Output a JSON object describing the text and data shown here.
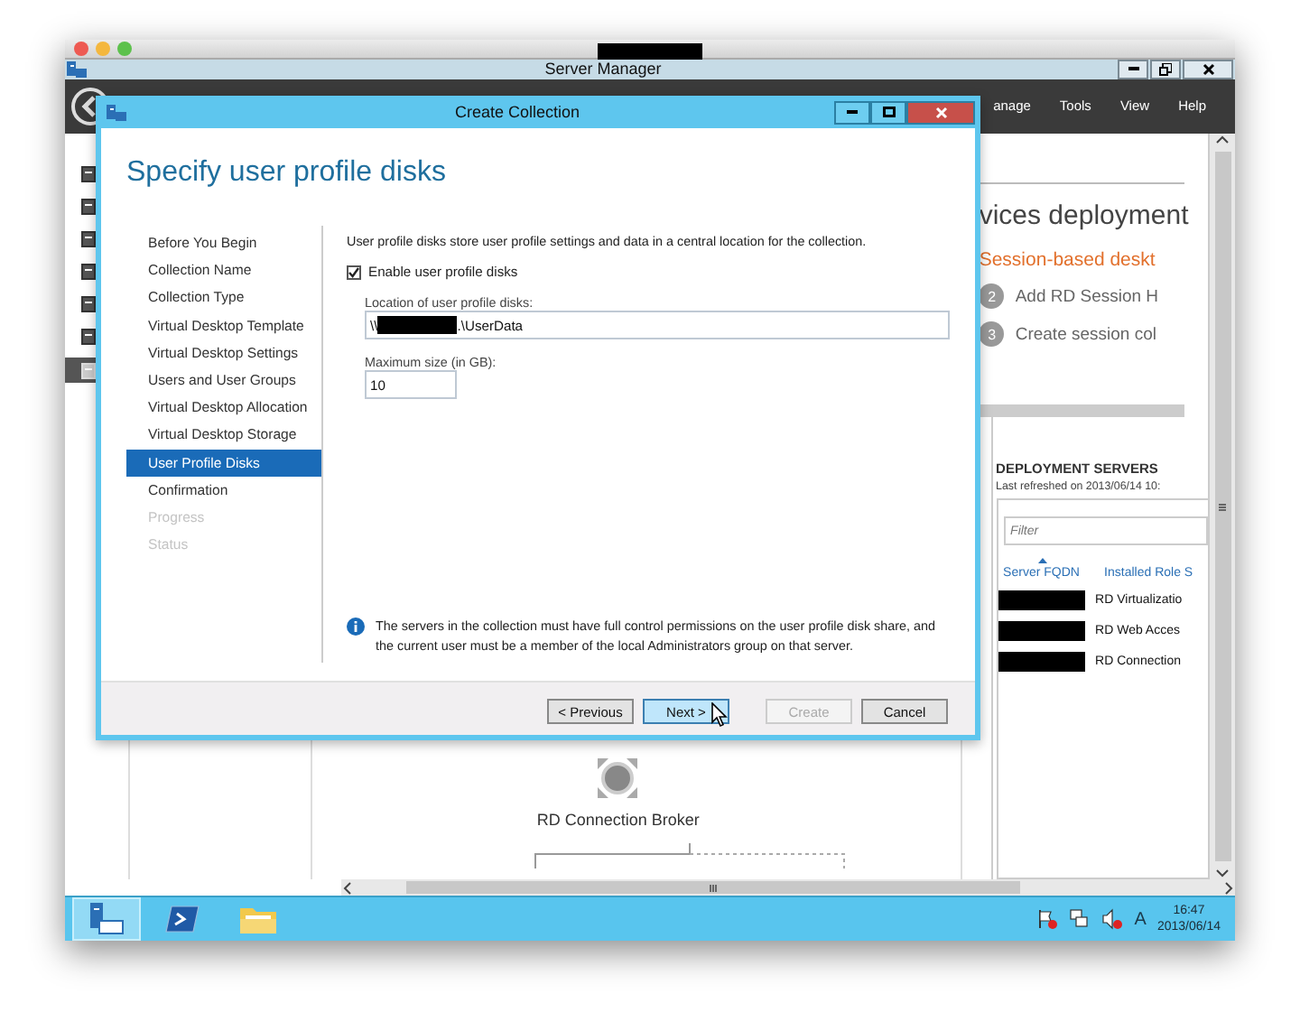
{
  "server_manager": {
    "title": "Server Manager",
    "menu": [
      "anage",
      "Tools",
      "View",
      "Help"
    ],
    "nav_items": [
      {
        "selected": false
      },
      {
        "selected": false
      },
      {
        "selected": false
      },
      {
        "selected": false
      },
      {
        "selected": false
      },
      {
        "selected": false
      },
      {
        "selected": true
      }
    ],
    "overview": {
      "heading": "vices deployment",
      "subheading": "Session-based deskt",
      "steps": [
        {
          "number": "2",
          "label": "Add RD Session H"
        },
        {
          "number": "3",
          "label": "Create session col"
        }
      ]
    },
    "diagram": {
      "node_label": "RD Connection Broker"
    },
    "deployment_servers": {
      "title": "DEPLOYMENT SERVERS",
      "last_refreshed": "Last refreshed on 2013/06/14 10:",
      "filter": {
        "placeholder": "Filter"
      },
      "columns": [
        "Server FQDN",
        "Installed Role S"
      ],
      "rows": [
        {
          "role": "RD Virtualizatio"
        },
        {
          "role": "RD Web Acces"
        },
        {
          "role": "RD Connection"
        }
      ]
    }
  },
  "dialog": {
    "title": "Create Collection",
    "heading": "Specify user profile disks",
    "steps": [
      {
        "label": "Before You Begin",
        "selected": false,
        "disabled": false
      },
      {
        "label": "Collection Name",
        "selected": false,
        "disabled": false
      },
      {
        "label": "Collection Type",
        "selected": false,
        "disabled": false
      },
      {
        "label": "Virtual Desktop Template",
        "selected": false,
        "disabled": false
      },
      {
        "label": "Virtual Desktop Settings",
        "selected": false,
        "disabled": false
      },
      {
        "label": "Users and User Groups",
        "selected": false,
        "disabled": false
      },
      {
        "label": "Virtual Desktop Allocation",
        "selected": false,
        "disabled": false
      },
      {
        "label": "Virtual Desktop Storage",
        "selected": false,
        "disabled": false
      },
      {
        "label": "User Profile Disks",
        "selected": true,
        "disabled": false
      },
      {
        "label": "Confirmation",
        "selected": false,
        "disabled": false
      },
      {
        "label": "Progress",
        "selected": false,
        "disabled": true
      },
      {
        "label": "Status",
        "selected": false,
        "disabled": true
      }
    ],
    "description": "User profile disks store user profile settings and data in a central location for the collection.",
    "enable_checkbox": {
      "label": "Enable user profile disks",
      "checked": true
    },
    "location": {
      "label": "Location of user profile disks:",
      "value_start": "\\\\",
      "value_end": ".\\UserData"
    },
    "max_size": {
      "label": "Maximum size (in GB):",
      "value": "10"
    },
    "note": "The servers in the collection must have full control permissions on the user profile disk share, and the current user must be a member of the local Administrators group on that server.",
    "buttons": [
      {
        "label": "< Previous",
        "kind": "normal"
      },
      {
        "label": "Next >",
        "kind": "hovered"
      },
      {
        "label": "Create",
        "kind": "disabled"
      },
      {
        "label": "Cancel",
        "kind": "normal"
      }
    ]
  },
  "taskbar": {
    "apps": [
      {
        "selected": true
      },
      {
        "selected": false
      },
      {
        "selected": false
      }
    ],
    "input_indicator": "A",
    "time": "16:47",
    "date": "2013/06/14"
  }
}
